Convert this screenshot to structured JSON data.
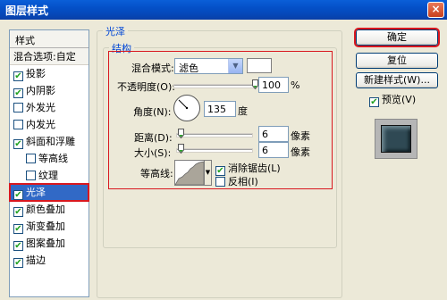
{
  "window": {
    "title": "图层样式",
    "close": "×"
  },
  "style_list": {
    "header": "样式",
    "blend_options": "混合选项:自定",
    "items": [
      {
        "label": "投影",
        "checked": true
      },
      {
        "label": "内阴影",
        "checked": true
      },
      {
        "label": "外发光",
        "checked": false
      },
      {
        "label": "内发光",
        "checked": false
      },
      {
        "label": "斜面和浮雕",
        "checked": true
      },
      {
        "label": "等高线",
        "checked": false
      },
      {
        "label": "纹理",
        "checked": false
      },
      {
        "label": "光泽",
        "checked": true
      },
      {
        "label": "颜色叠加",
        "checked": true
      },
      {
        "label": "渐变叠加",
        "checked": true
      },
      {
        "label": "图案叠加",
        "checked": true
      },
      {
        "label": "描边",
        "checked": true
      }
    ],
    "check_glyph": "✔"
  },
  "panel": {
    "group_title": "光泽",
    "section_title": "结构",
    "blend_mode_label": "混合模式:",
    "blend_mode_value": "滤色",
    "opacity_label": "不透明度(O):",
    "opacity_value": "100",
    "opacity_unit": "%",
    "opacity_fraction": 1.0,
    "angle_label": "角度(N):",
    "angle_value": "135",
    "angle_unit": "度",
    "distance_label": "距离(D):",
    "distance_value": "6",
    "distance_unit": "像素",
    "distance_fraction": 0.03,
    "size_label": "大小(S):",
    "size_value": "6",
    "size_unit": "像素",
    "size_fraction": 0.03,
    "contour_label": "等高线:",
    "antialias_label": "消除锯齿(L)",
    "antialias_checked": true,
    "invert_label": "反相(I)",
    "invert_checked": false
  },
  "buttons": {
    "ok": "确定",
    "reset": "复位",
    "new_style": "新建样式(W)...",
    "preview_label": "预览(V)",
    "preview_checked": true
  },
  "colors": {
    "accent_red": "#d9181f",
    "selection": "#3169c6",
    "preview_fill": "#2f4954"
  }
}
